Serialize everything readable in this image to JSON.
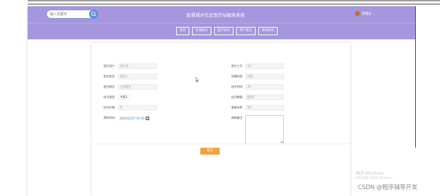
{
  "header": {
    "site_title": "智慧城乡社区医疗站服务系统",
    "search_placeholder": "输入关键字",
    "user_name": "管理员",
    "chevron": "⌄"
  },
  "nav": {
    "items": [
      {
        "label": "首页"
      },
      {
        "label": "在线挂号"
      },
      {
        "label": "医疗资讯"
      },
      {
        "label": "用户留言"
      },
      {
        "label": "新闻资讯"
      }
    ]
  },
  "form": {
    "left": [
      {
        "label": "医生用户",
        "value": "用户名"
      },
      {
        "label": "医生姓名",
        "value": "医生1"
      },
      {
        "label": "医生职位",
        "value": "主任医生"
      },
      {
        "label": "挂号类型",
        "value": "专家1"
      },
      {
        "label": "挂号价格",
        "value": "9"
      },
      {
        "label": "预约时间",
        "value": "2023/12/27 15:30"
      }
    ],
    "right": [
      {
        "label": "医生工号",
        "value": "12"
      },
      {
        "label": "所属科室",
        "value": "内科"
      },
      {
        "label": "挂号时间",
        "value": "10"
      },
      {
        "label": "挂号数量",
        "value": "医师1"
      },
      {
        "label": "患者年龄",
        "value": "58"
      },
      {
        "label": "病例备注",
        "value": ""
      }
    ],
    "submit_label": "提交"
  },
  "overlay": {
    "activation_title": "激活 Windows",
    "activation_sub": "转到\"设置\"以激活 Windows。",
    "watermark": "CSDN @程序辅导开发"
  }
}
